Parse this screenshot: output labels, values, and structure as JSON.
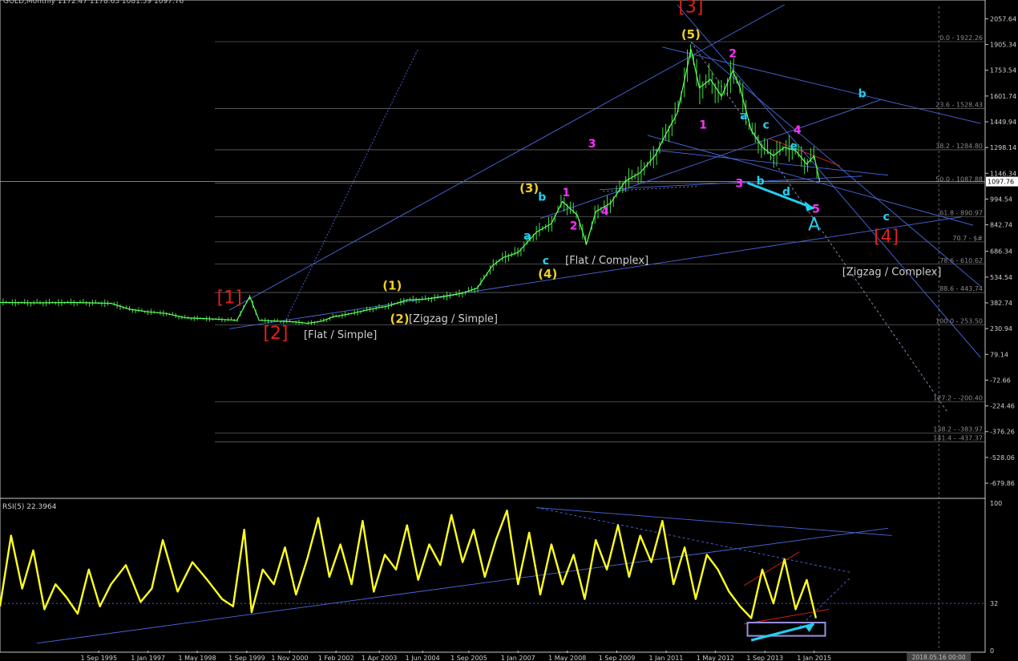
{
  "header": {
    "symbol_line": "GOLD,Monthly  1172.47 1178.63 1081.59 1097.76"
  },
  "chart_data": [
    {
      "type": "line",
      "name": "price-panel",
      "series_name": "GOLD,Monthly",
      "ylim": [
        -760,
        2130
      ],
      "y_ticks": [
        "2057.64",
        "1905.34",
        "1753.54",
        "1601.74",
        "1449.94",
        "1298.14",
        "1146.34",
        "994.54",
        "842.74",
        "686.34",
        "534.54",
        "382.74",
        "230.94",
        "79.14",
        "-72.66",
        "-224.46",
        "-376.26",
        "-528.06",
        "-679.86"
      ],
      "y_tick_values": [
        2057.64,
        1905.34,
        1753.54,
        1601.74,
        1449.94,
        1298.14,
        1146.34,
        994.54,
        842.74,
        686.34,
        534.54,
        382.74,
        230.94,
        79.14,
        -72.66,
        -224.46,
        -376.26,
        -528.06,
        -679.86
      ],
      "current_price": "1097.76",
      "current_price_value": 1097.76,
      "fib_levels": [
        {
          "label": "0.0 - 1922.26",
          "value": 1922.26
        },
        {
          "label": "23.6 - 1528.43",
          "value": 1528.43
        },
        {
          "label": "38.2 - 1284.80",
          "value": 1284.8
        },
        {
          "label": "50.0 - 1087.88",
          "value": 1087.88
        },
        {
          "label": "61.8 - 890.97",
          "value": 890.97
        },
        {
          "label": "70.7 - $#",
          "value": 742.3
        },
        {
          "label": "78.6 - 610.62",
          "value": 610.62
        },
        {
          "label": "88.6 - 443.74",
          "value": 443.74
        },
        {
          "label": "100.0 - 253.50",
          "value": 253.5
        },
        {
          "label": "127.2 - -200.40",
          "value": -200.4
        },
        {
          "label": "138.2 - -383.97",
          "value": -383.97
        },
        {
          "label": "141.4 - -437.37",
          "value": -437.37
        }
      ],
      "x_ticks": [
        "1 Sep 1995",
        "1 Jan 1997",
        "1 May 1998",
        "1 Sep 1999",
        "1 Nov 2000",
        "1 Feb 2002",
        "1 Apr 2003",
        "1 Jun 2004",
        "1 Sep 2005",
        "1 Jan 2007",
        "1 May 2008",
        "1 Sep 2009",
        "1 Jan 2011",
        "1 May 2012",
        "1 Sep 2013",
        "1 Jan 2015"
      ],
      "x_tick_years": [
        1995.67,
        1997.0,
        1998.33,
        1999.67,
        2000.83,
        2002.08,
        2003.25,
        2004.42,
        2005.67,
        2007.0,
        2008.33,
        2009.67,
        2011.0,
        2012.33,
        2013.67,
        2015.0
      ],
      "date_marker": "2018.05.16 00:00",
      "date_marker_year": 2018.37,
      "series": [
        {
          "x": [
            1993.0,
            1994.0,
            1995.0,
            1996.0,
            1996.5,
            1997.0,
            1997.5,
            1998.0,
            1998.5,
            1999.0,
            1999.4,
            1999.75,
            2000.0,
            2000.5,
            2001.0,
            2001.3,
            2001.7,
            2002.0,
            2002.5,
            2003.0,
            2003.5,
            2004.0,
            2004.5,
            2005.0,
            2005.5,
            2005.9,
            2006.3,
            2006.6,
            2007.0,
            2007.5,
            2007.9,
            2008.2,
            2008.6,
            2008.85,
            2009.1,
            2009.5,
            2009.9,
            2010.3,
            2010.7,
            2011.0,
            2011.3,
            2011.6,
            2011.67,
            2011.9,
            2012.2,
            2012.5,
            2012.8,
            2013.0,
            2013.3,
            2013.6,
            2013.9,
            2014.2,
            2014.5,
            2014.8,
            2015.0,
            2015.15
          ],
          "y": [
            385,
            383,
            385,
            380,
            345,
            330,
            320,
            295,
            290,
            285,
            280,
            420,
            280,
            275,
            270,
            262,
            275,
            300,
            320,
            345,
            365,
            400,
            405,
            420,
            440,
            470,
            600,
            650,
            680,
            800,
            850,
            980,
            900,
            730,
            920,
            970,
            1100,
            1150,
            1250,
            1380,
            1500,
            1800,
            1880,
            1650,
            1700,
            1600,
            1750,
            1650,
            1400,
            1300,
            1250,
            1300,
            1280,
            1200,
            1250,
            1098
          ]
        }
      ],
      "annotations": [
        {
          "text": "[1]",
          "x": 1999.2,
          "y": 380,
          "color": "#e02020"
        },
        {
          "text": "[2]",
          "x": 2000.45,
          "y": 170,
          "color": "#e02020"
        },
        {
          "text": "[Flat / Simple]",
          "x": 2002.2,
          "y": 175,
          "color": "#d0d0d0"
        },
        {
          "text": "(1)",
          "x": 2003.6,
          "y": 460,
          "color": "#f0d020"
        },
        {
          "text": "(2)",
          "x": 2003.8,
          "y": 265,
          "color": "#f0d020"
        },
        {
          "text": "[Zigzag / Simple]",
          "x": 2005.25,
          "y": 270,
          "color": "#d0d0d0"
        },
        {
          "text": "(3)",
          "x": 2007.3,
          "y": 1035,
          "color": "#f0d020"
        },
        {
          "text": "b",
          "x": 2007.65,
          "y": 985,
          "color": "#20d0f0"
        },
        {
          "text": "a",
          "x": 2007.25,
          "y": 755,
          "color": "#20d0f0"
        },
        {
          "text": "c",
          "x": 2007.75,
          "y": 610,
          "color": "#20d0f0"
        },
        {
          "text": "(4)",
          "x": 2007.8,
          "y": 530,
          "color": "#f0d020"
        },
        {
          "text": "1",
          "x": 2008.3,
          "y": 1010,
          "color": "#ff30ff"
        },
        {
          "text": "2",
          "x": 2008.5,
          "y": 815,
          "color": "#ff30ff"
        },
        {
          "text": "3",
          "x": 2009.0,
          "y": 1300,
          "color": "#ff30ff"
        },
        {
          "text": "4",
          "x": 2009.35,
          "y": 900,
          "color": "#ff30ff"
        },
        {
          "text": "[Flat / Complex]",
          "x": 2009.4,
          "y": 615,
          "color": "#d0d0d0"
        },
        {
          "text": "[3]",
          "x": 2011.67,
          "y": 2095,
          "color": "#e02020"
        },
        {
          "text": "(5)",
          "x": 2011.67,
          "y": 1940,
          "color": "#f0d020"
        },
        {
          "text": "2",
          "x": 2012.8,
          "y": 1830,
          "color": "#ff30ff"
        },
        {
          "text": "1",
          "x": 2012.0,
          "y": 1410,
          "color": "#ff30ff"
        },
        {
          "text": "a",
          "x": 2013.1,
          "y": 1465,
          "color": "#20d0f0"
        },
        {
          "text": "c",
          "x": 2013.7,
          "y": 1410,
          "color": "#20d0f0"
        },
        {
          "text": "4",
          "x": 2014.55,
          "y": 1380,
          "color": "#ff30ff"
        },
        {
          "text": "e",
          "x": 2014.45,
          "y": 1285,
          "color": "#20d0f0"
        },
        {
          "text": "3",
          "x": 2012.98,
          "y": 1065,
          "color": "#ff30ff"
        },
        {
          "text": "b",
          "x": 2013.55,
          "y": 1080,
          "color": "#20d0f0"
        },
        {
          "text": "d",
          "x": 2014.25,
          "y": 1015,
          "color": "#20d0f0"
        },
        {
          "text": "5",
          "x": 2015.05,
          "y": 915,
          "color": "#ff30ff"
        },
        {
          "text": "A",
          "x": 2015.0,
          "y": 810,
          "color": "#20d0f0"
        },
        {
          "text": "b",
          "x": 2016.3,
          "y": 1595,
          "color": "#20d0f0"
        },
        {
          "text": "c",
          "x": 2016.95,
          "y": 870,
          "color": "#20d0f0"
        },
        {
          "text": "[4]",
          "x": 2016.95,
          "y": 740,
          "color": "#e02020"
        },
        {
          "text": "[Zigzag / Complex]",
          "x": 2017.1,
          "y": 545,
          "color": "#d0d0d0"
        }
      ]
    },
    {
      "type": "line",
      "name": "rsi-panel",
      "title": "RSI(5) 22.3964",
      "ylim": [
        0,
        100
      ],
      "y_ticks": [
        "100",
        "32",
        "0"
      ],
      "y_tick_values": [
        100,
        32,
        0
      ],
      "levels": [
        32
      ],
      "series": [
        {
          "x": [
            1993.0,
            1993.3,
            1993.6,
            1993.9,
            1994.2,
            1994.5,
            1994.8,
            1995.1,
            1995.4,
            1995.7,
            1996.0,
            1996.4,
            1996.8,
            1997.1,
            1997.4,
            1997.8,
            1998.2,
            1998.6,
            1999.0,
            1999.3,
            1999.6,
            1999.8,
            2000.1,
            2000.4,
            2000.7,
            2001.0,
            2001.3,
            2001.6,
            2001.9,
            2002.2,
            2002.5,
            2002.8,
            2003.1,
            2003.4,
            2003.7,
            2004.0,
            2004.3,
            2004.6,
            2004.9,
            2005.2,
            2005.5,
            2005.8,
            2006.1,
            2006.4,
            2006.7,
            2007.0,
            2007.3,
            2007.6,
            2007.9,
            2008.2,
            2008.5,
            2008.8,
            2009.1,
            2009.4,
            2009.7,
            2010.0,
            2010.3,
            2010.6,
            2010.9,
            2011.2,
            2011.5,
            2011.8,
            2012.1,
            2012.4,
            2012.7,
            2013.0,
            2013.3,
            2013.6,
            2013.9,
            2014.2,
            2014.5,
            2014.8,
            2015.05
          ],
          "y": [
            30,
            78,
            42,
            68,
            28,
            45,
            36,
            25,
            55,
            30,
            45,
            58,
            33,
            42,
            75,
            40,
            60,
            48,
            35,
            30,
            82,
            26,
            55,
            45,
            70,
            38,
            62,
            90,
            50,
            72,
            45,
            88,
            40,
            65,
            55,
            85,
            48,
            72,
            58,
            92,
            60,
            82,
            50,
            75,
            95,
            45,
            80,
            38,
            72,
            45,
            65,
            35,
            75,
            55,
            85,
            50,
            78,
            60,
            88,
            45,
            70,
            35,
            65,
            55,
            40,
            30,
            22,
            55,
            32,
            62,
            28,
            48,
            22
          ]
        }
      ]
    }
  ]
}
